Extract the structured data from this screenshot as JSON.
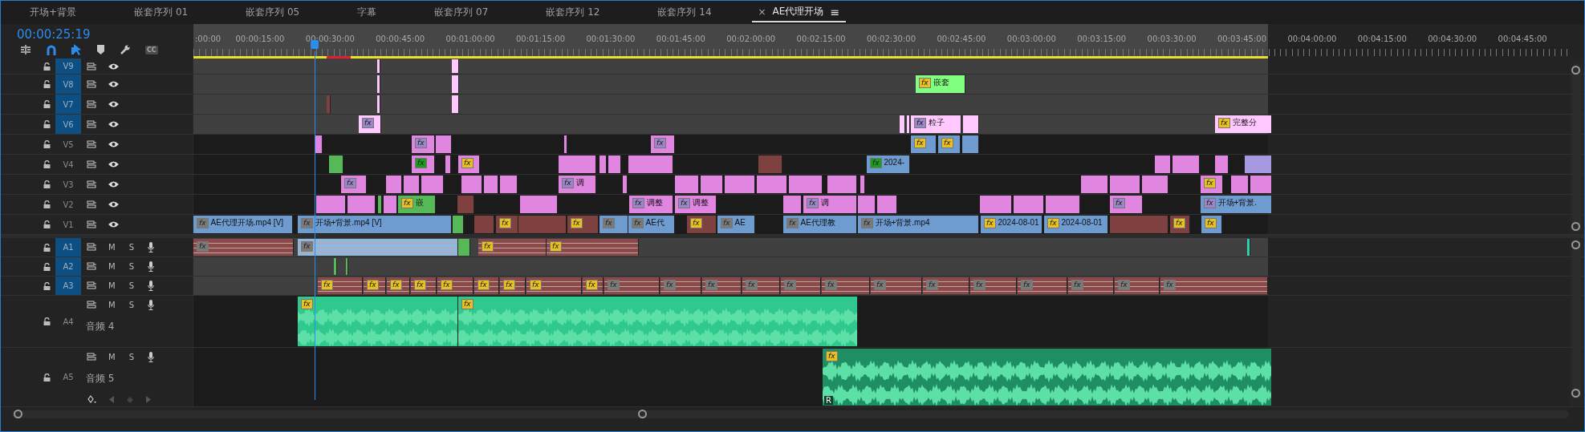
{
  "tabs": [
    {
      "label": "开场+背景",
      "selected": false
    },
    {
      "label": "嵌套序列 01",
      "selected": false
    },
    {
      "label": "嵌套序列 05",
      "selected": false
    },
    {
      "label": "字幕",
      "selected": false
    },
    {
      "label": "嵌套序列 07",
      "selected": false
    },
    {
      "label": "嵌套序列 12",
      "selected": false
    },
    {
      "label": "嵌套序列 14",
      "selected": false
    },
    {
      "label": "AE代理开场",
      "selected": true,
      "close": "×",
      "menu": "≡"
    }
  ],
  "timecode": "00:00:25:19",
  "captions_button": "CC",
  "ruler": {
    "ticks": [
      ":00:00",
      "00:00:15:00",
      "00:00:30:00",
      "00:00:45:00",
      "00:01:00:00",
      "00:01:15:00",
      "00:01:30:00",
      "00:01:45:00",
      "00:02:00:00",
      "00:02:15:00",
      "00:02:30:00",
      "00:02:45:00",
      "00:03:00:00",
      "00:03:15:00",
      "00:03:30:00",
      "00:03:45:00",
      "00:04:00:00",
      "00:04:15:00",
      "00:04:30:00",
      "00:04:45:00"
    ]
  },
  "video_tracks": [
    {
      "name": "V9",
      "targeted": true
    },
    {
      "name": "V8",
      "targeted": true,
      "clips": [
        {
          "badge": {
            "text": "fx",
            "color": "#e8c020"
          },
          "label": "嵌套",
          "color": "#80ff80"
        }
      ]
    },
    {
      "name": "V7",
      "targeted": true
    },
    {
      "name": "V6",
      "targeted": true,
      "clips": [
        {
          "badge": {
            "text": "fx",
            "color": "#9a86c8"
          },
          "color": "#ffc8ff"
        },
        {
          "badge": {
            "text": "fx",
            "color": "#9a86c8"
          },
          "label": "粒子",
          "color": "#ffc8ff"
        },
        {
          "badge": {
            "text": "fx",
            "color": "#e8c020"
          },
          "label": "完整分",
          "color": "#ffc8ff"
        }
      ]
    },
    {
      "name": "V5",
      "targeted": false,
      "clips": [
        {
          "badge": {
            "text": "fx",
            "color": "#9a86c8"
          },
          "color": "#e085e0"
        },
        {
          "badge": {
            "text": "fx",
            "color": "#9a86c8"
          },
          "color": "#e085e0"
        },
        {
          "badge": {
            "text": "fx",
            "color": "#e8c020"
          },
          "color": "#6e9bd0"
        },
        {
          "badge": {
            "text": "fx",
            "color": "#e8c020"
          },
          "color": "#6e9bd0"
        }
      ]
    },
    {
      "name": "V4",
      "targeted": false,
      "clips": [
        {
          "badge": {
            "text": "fx",
            "color": "#1e9a1e"
          },
          "color": "#e085e0"
        },
        {
          "badge": {
            "text": "fx",
            "color": "#e8c020"
          },
          "color": "#e085e0"
        },
        {
          "badge": {
            "text": "fx",
            "color": "#1e9a1e"
          },
          "label": "2024-",
          "color": "#6e9bd0"
        }
      ]
    },
    {
      "name": "V3",
      "targeted": false,
      "clips": [
        {
          "badge": {
            "text": "fx",
            "color": "#9a86c8"
          },
          "color": "#e085e0"
        },
        {
          "badge": {
            "text": "fx",
            "color": "#9a86c8"
          },
          "label": "调",
          "color": "#e085e0"
        },
        {
          "badge": {
            "text": "fx",
            "color": "#e8c020"
          },
          "color": "#e085e0"
        }
      ]
    },
    {
      "name": "V2",
      "targeted": false,
      "clips": [
        {
          "badge": {
            "text": "fx",
            "color": "#e8c020"
          },
          "label": "嵌",
          "color": "#57b857"
        },
        {
          "badge": {
            "text": "fx",
            "color": "#9a86c8"
          },
          "label": "调整",
          "color": "#e085e0"
        },
        {
          "badge": {
            "text": "fx",
            "color": "#9a86c8"
          },
          "label": "调整",
          "color": "#e085e0"
        },
        {
          "badge": {
            "text": "fx",
            "color": "#9a86c8"
          },
          "label": "调",
          "color": "#e085e0"
        },
        {
          "badge": {
            "text": "fx",
            "color": "#9a86c8"
          },
          "color": "#e085e0"
        },
        {
          "badge": {
            "text": "fx",
            "color": "#9a86c8"
          },
          "label": "开场+背景.",
          "color": "#6e9bd0"
        }
      ]
    },
    {
      "name": "V1",
      "targeted": false,
      "clips": [
        {
          "badge": {
            "text": "fx",
            "color": "#7a7a7a"
          },
          "label": "AE代理开场.mp4 [V]",
          "color": "#6e9bd0"
        },
        {
          "badge": {
            "text": "fx",
            "color": "#7a7a7a"
          },
          "label": "开场+背景.mp4 [V]",
          "color": "#6e9bd0"
        },
        {
          "badge": {
            "text": "fx",
            "color": "#e8c020"
          },
          "color": "#7f4040"
        },
        {
          "badge": {
            "text": "fx",
            "color": "#e8c020"
          },
          "color": "#7f4040"
        },
        {
          "badge": {
            "text": "fx",
            "color": "#7a7a7a"
          },
          "color": "#6e9bd0"
        },
        {
          "badge": {
            "text": "fx",
            "color": "#7a7a7a"
          },
          "label": "AE代",
          "color": "#6e9bd0"
        },
        {
          "badge": {
            "text": "fx",
            "color": "#e8c020"
          },
          "color": "#7f4040"
        },
        {
          "badge": {
            "text": "fx",
            "color": "#7a7a7a"
          },
          "label": "AE",
          "color": "#6e9bd0"
        },
        {
          "badge": {
            "text": "fx",
            "color": "#7a7a7a"
          },
          "label": "AE代理教",
          "color": "#6e9bd0"
        },
        {
          "badge": {
            "text": "fx",
            "color": "#7a7a7a"
          },
          "label": "开场+背景.mp4",
          "color": "#6e9bd0"
        },
        {
          "badge": {
            "text": "fx",
            "color": "#e8c020"
          },
          "label": "2024-08-01",
          "color": "#6e9bd0"
        },
        {
          "badge": {
            "text": "fx",
            "color": "#e8c020"
          },
          "label": "2024-08-01",
          "color": "#6e9bd0"
        },
        {
          "badge": {
            "text": "fx",
            "color": "#e8c020"
          },
          "color": "#7f4040"
        },
        {
          "badge": {
            "text": "fx",
            "color": "#e8c020"
          },
          "color": "#6e9bd0"
        }
      ]
    }
  ],
  "audio_tracks": [
    {
      "name": "A1",
      "targeted": true,
      "mute": "M",
      "solo": "S",
      "clips": [
        {
          "badge": {
            "text": "fx",
            "color": "#7a7a7a"
          },
          "kind": "stripes",
          "color": "#8a4a4a"
        },
        {
          "badge": {
            "text": "fx",
            "color": "#7a7a7a"
          },
          "kind": "stripes",
          "color": "#8fb8e0"
        },
        {
          "badge": {
            "text": "fx",
            "color": "#e8c020"
          },
          "kind": "stripes",
          "color": "#8a4a4a"
        },
        {
          "badge": {
            "text": "fx",
            "color": "#e8c020"
          },
          "kind": "stripes",
          "color": "#8a4a4a"
        }
      ]
    },
    {
      "name": "A2",
      "targeted": true,
      "mute": "M",
      "solo": "S"
    },
    {
      "name": "A3",
      "targeted": true,
      "mute": "M",
      "solo": "S",
      "clips": [
        {
          "badge": {
            "text": "fx",
            "color": "#e8c020"
          },
          "kind": "stripes",
          "color": "#8a4a4a"
        },
        {
          "badge": {
            "text": "fx",
            "color": "#e8c020"
          },
          "kind": "stripes",
          "color": "#8a4a4a"
        },
        {
          "badge": {
            "text": "fx",
            "color": "#e8c020"
          },
          "kind": "stripes",
          "color": "#8a4a4a"
        },
        {
          "badge": {
            "text": "fx",
            "color": "#e8c020"
          },
          "kind": "stripes",
          "color": "#8a4a4a"
        },
        {
          "badge": {
            "text": "fx",
            "color": "#e8c020"
          },
          "kind": "stripes",
          "color": "#8a4a4a"
        },
        {
          "badge": {
            "text": "fx",
            "color": "#e8c020"
          },
          "kind": "stripes",
          "color": "#8a4a4a"
        },
        {
          "badge": {
            "text": "fx",
            "color": "#e8c020"
          },
          "kind": "stripes",
          "color": "#8a4a4a"
        },
        {
          "badge": {
            "text": "fx",
            "color": "#e8c020"
          },
          "kind": "stripes",
          "color": "#8a4a4a"
        },
        {
          "badge": {
            "text": "fx",
            "color": "#e8c020"
          },
          "kind": "stripes",
          "color": "#8a4a4a"
        },
        {
          "badge": {
            "text": "fx",
            "color": "#7a7a7a"
          },
          "kind": "stripes",
          "color": "#8a4a4a"
        },
        {
          "badge": {
            "text": "fx",
            "color": "#7a7a7a"
          },
          "kind": "stripes",
          "color": "#8a4a4a"
        },
        {
          "badge": {
            "text": "fx",
            "color": "#7a7a7a"
          },
          "kind": "stripes",
          "color": "#8a4a4a"
        },
        {
          "badge": {
            "text": "fx",
            "color": "#7a7a7a"
          },
          "kind": "stripes",
          "color": "#8a4a4a"
        },
        {
          "badge": {
            "text": "fx",
            "color": "#7a7a7a"
          },
          "kind": "stripes",
          "color": "#8a4a4a"
        },
        {
          "badge": {
            "text": "fx",
            "color": "#7a7a7a"
          },
          "kind": "stripes",
          "color": "#8a4a4a"
        },
        {
          "badge": {
            "text": "fx",
            "color": "#7a7a7a"
          },
          "kind": "stripes",
          "color": "#8a4a4a"
        },
        {
          "badge": {
            "text": "fx",
            "color": "#7a7a7a"
          },
          "kind": "stripes",
          "color": "#8a4a4a"
        },
        {
          "badge": {
            "text": "fx",
            "color": "#7a7a7a"
          },
          "kind": "stripes",
          "color": "#8a4a4a"
        },
        {
          "badge": {
            "text": "fx",
            "color": "#7a7a7a"
          },
          "kind": "stripes",
          "color": "#8a4a4a"
        },
        {
          "badge": {
            "text": "fx",
            "color": "#7a7a7a"
          },
          "kind": "stripes",
          "color": "#8a4a4a"
        },
        {
          "badge": {
            "text": "fx",
            "color": "#7a7a7a"
          },
          "kind": "stripes",
          "color": "#8a4a4a"
        },
        {
          "badge": {
            "text": "fx",
            "color": "#7a7a7a"
          },
          "kind": "stripes",
          "color": "#8a4a4a"
        }
      ]
    },
    {
      "name": "A4",
      "targeted": false,
      "mute": "M",
      "solo": "S",
      "title": "音频 4",
      "clips": [
        {
          "badge": {
            "text": "fx",
            "color": "#e8c020"
          },
          "kind": "waveform",
          "color": "#2fc88e"
        },
        {
          "badge": {
            "text": "fx",
            "color": "#e8c020"
          },
          "kind": "waveform",
          "color": "#2fc88e"
        }
      ]
    },
    {
      "name": "A5",
      "targeted": false,
      "mute": "M",
      "solo": "S",
      "title": "音频 5",
      "keyframes": true,
      "clips": [
        {
          "badge": {
            "text": "fx",
            "color": "#e8c020"
          },
          "kind": "waveform",
          "color": "#1f8f63",
          "channel_label": "R"
        }
      ]
    }
  ]
}
